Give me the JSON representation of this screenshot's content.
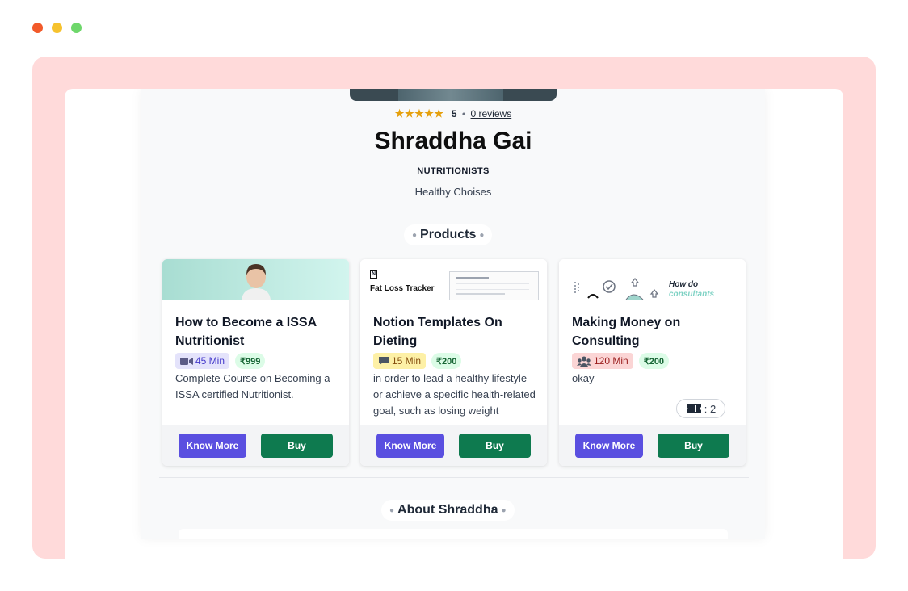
{
  "window_controls": {
    "close_color": "#f25a2a",
    "minimize_color": "#f6c22e",
    "maximize_color": "#6ed76b"
  },
  "profile": {
    "rating_stars": "★★★★★",
    "rating_value": "5",
    "rating_separator": "•",
    "reviews_link": "0 reviews",
    "name": "Shraddha Gai",
    "category": "NUTRITIONISTS",
    "tagline": "Healthy Choises"
  },
  "sections": {
    "products_title": "Products",
    "about_title": "About Shraddha"
  },
  "products": [
    {
      "title": "How to Become a ISSA Nutritionist",
      "duration": "45 Min",
      "duration_icon": "video-camera-icon",
      "price": "₹999",
      "description": "Complete Course on Becoming a ISSA certified Nutritionist.",
      "know_more_label": "Know More",
      "buy_label": "Buy"
    },
    {
      "title": "Notion Templates On Dieting",
      "duration": "15 Min",
      "duration_icon": "chat-bubble-icon",
      "price": "₹200",
      "description": "in order to lead a healthy lifestyle or achieve a specific health-related goal, such as losing weight",
      "thumb_logo": "N",
      "thumb_title": "Fat Loss Tracker",
      "know_more_label": "Know More",
      "buy_label": "Buy"
    },
    {
      "title": "Making Money on Consulting",
      "duration": "120 Min",
      "duration_icon": "group-icon",
      "price": "₹200",
      "description": "okay",
      "thumb_heading": "How do",
      "thumb_subheading": "consultants",
      "quota_value": ": 2",
      "know_more_label": "Know More",
      "buy_label": "Buy"
    }
  ],
  "colors": {
    "frame_bg": "#ffdada",
    "primary_button": "#5a4fe0",
    "buy_button": "#0e7a4f",
    "star": "#e5a00d"
  }
}
